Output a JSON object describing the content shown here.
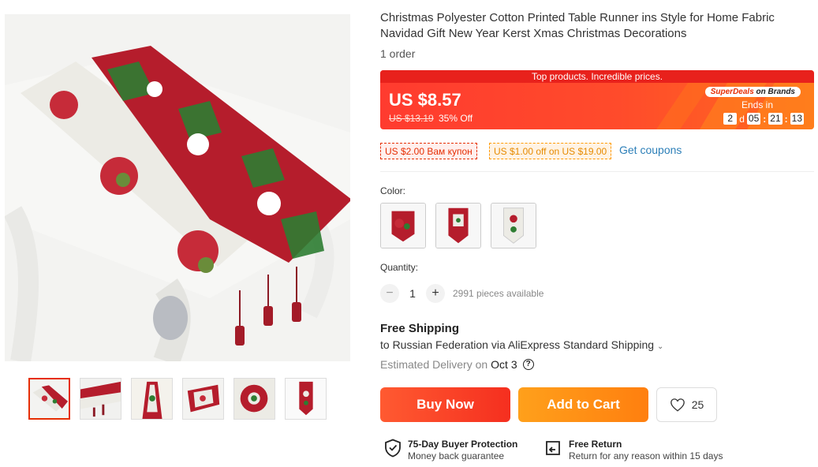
{
  "product": {
    "title": "Christmas Polyester Cotton Printed Table Runner ins Style for Home Fabric Navidad Gift New Year Kerst Xmas Christmas Decorations",
    "orders": "1 order"
  },
  "banner": {
    "headline": "Top products. Incredible prices.",
    "price": "US $8.57",
    "original_price": "US $13.19",
    "discount": "35% Off",
    "badge_prefix": "SuperDeals",
    "badge_suffix": " on Brands",
    "ends_in": "Ends in",
    "countdown": {
      "days": "2",
      "days_unit": "d",
      "hours": "05",
      "minutes": "21",
      "seconds": "13",
      "separator": ":"
    }
  },
  "coupons": {
    "coupon_1": "US $2.00 Вам купон",
    "coupon_2": "US $1.00 off on US $19.00",
    "link": "Get coupons"
  },
  "color": {
    "label": "Color:",
    "options": [
      "swatch-1",
      "swatch-2",
      "swatch-3"
    ]
  },
  "quantity": {
    "label": "Quantity:",
    "minus": "−",
    "plus": "+",
    "value": "1",
    "available": "2991 pieces available"
  },
  "shipping": {
    "title": "Free Shipping",
    "to": "to Russian Federation via AliExpress Standard Shipping",
    "caret": "⌄",
    "est_prefix": "Estimated Delivery on",
    "est_date": "Oct 3",
    "help_icon": "?"
  },
  "actions": {
    "buy_now": "Buy Now",
    "add_to_cart": "Add to Cart",
    "wishlist_count": "25"
  },
  "guarantees": {
    "protection_title": "75-Day Buyer Protection",
    "protection_sub": "Money back guarantee",
    "return_title": "Free Return",
    "return_sub": "Return for any reason within 15 days"
  },
  "colors": {
    "accent_red": "#e62e04",
    "buy_now": "#f52f1f",
    "add_to_cart": "#ff8a12",
    "link_blue": "#2c7fb8"
  },
  "icons": [
    "heart-icon",
    "shield-check-icon",
    "return-box-icon",
    "help-circle-icon",
    "chevron-down-icon"
  ]
}
